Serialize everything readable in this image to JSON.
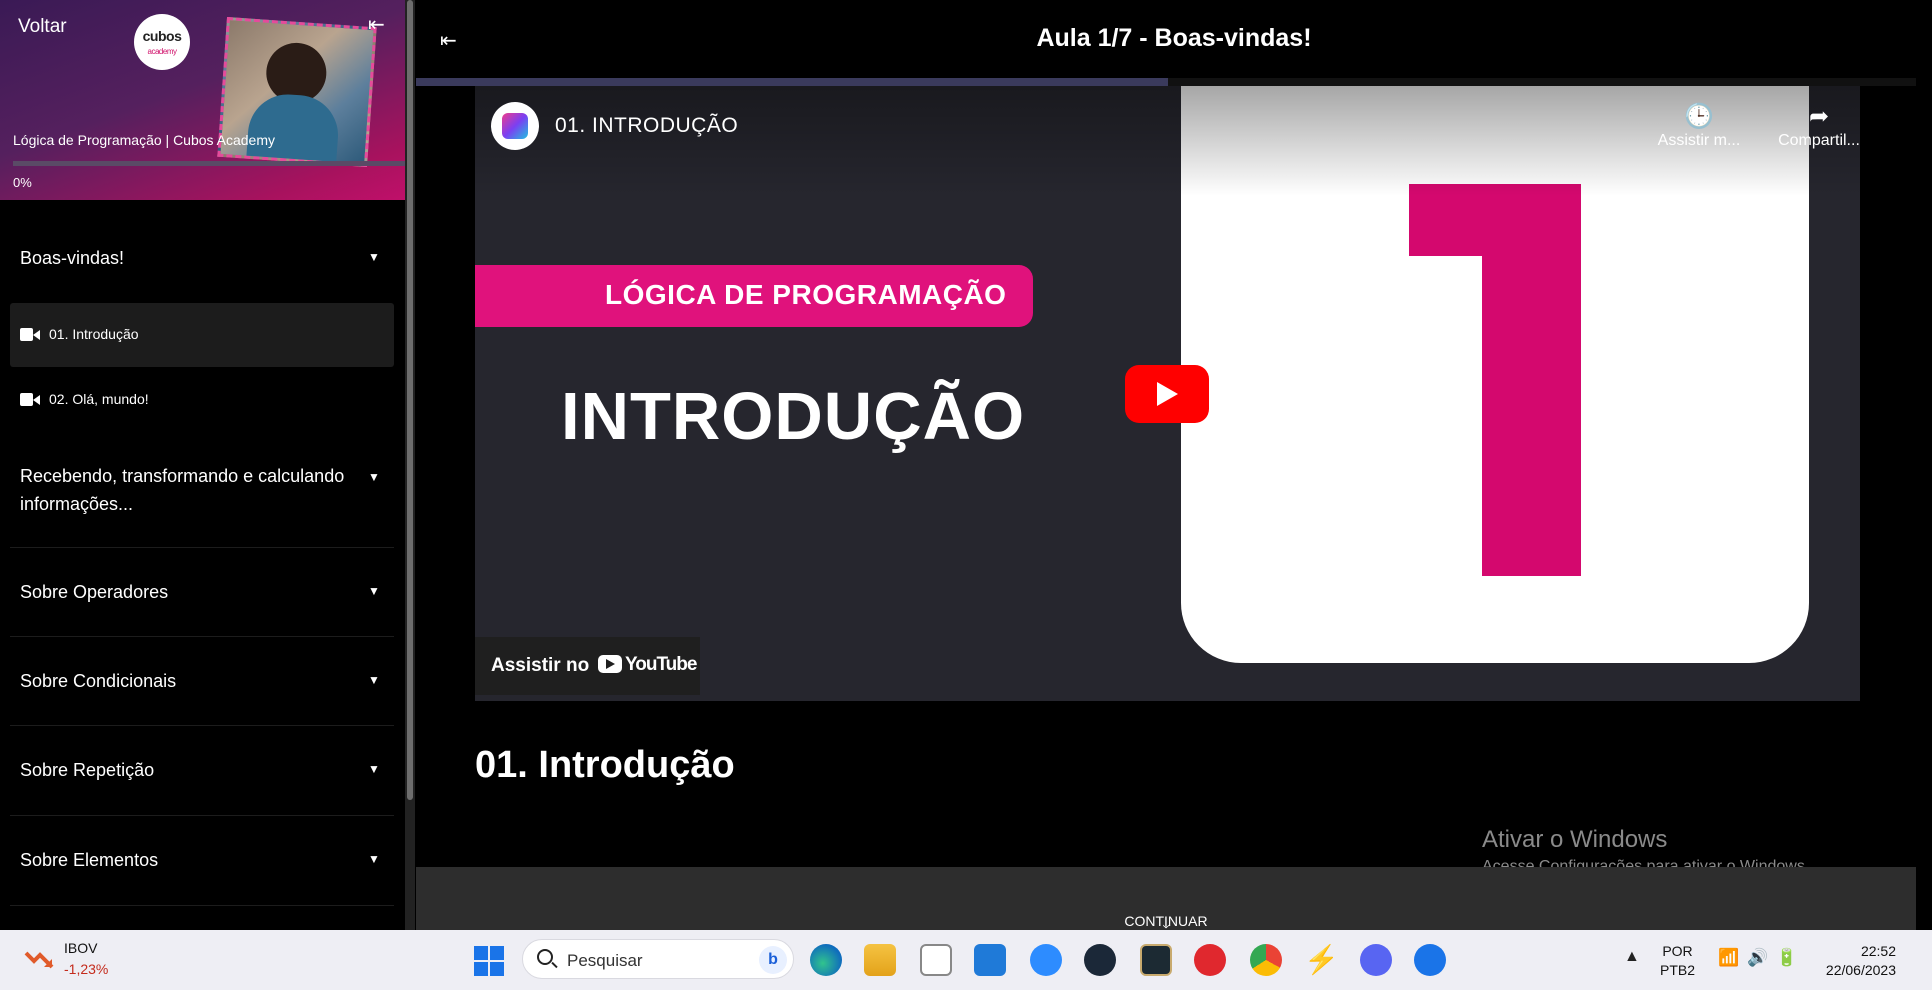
{
  "sidebar": {
    "back_label": "Voltar",
    "logo_text": "cubos",
    "logo_sub": "academy",
    "course_title": "Lógica de Programação | Cubos Academy",
    "progress_text": "0%",
    "progress_value": 0,
    "sections": [
      {
        "label": "Boas-vindas!",
        "expanded": true
      },
      {
        "label": "Recebendo, transformando e calculando informações...",
        "expanded": false
      },
      {
        "label": "Sobre Operadores",
        "expanded": false
      },
      {
        "label": "Sobre Condicionais",
        "expanded": false
      },
      {
        "label": "Sobre Repetição",
        "expanded": false
      },
      {
        "label": "Sobre Elementos",
        "expanded": false
      }
    ],
    "lessons": [
      {
        "label": "01. Introdução",
        "active": true
      },
      {
        "label": "02. Olá, mundo!",
        "active": false
      }
    ]
  },
  "header": {
    "title": "Aula 1/7 - Boas-vindas!"
  },
  "video": {
    "title": "01. INTRODUÇÃO",
    "watch_later": "Assistir m...",
    "share": "Compartil...",
    "banner": "LÓGICA DE PROGRAMAÇÃO",
    "heading": "INTRODUÇÃO",
    "watch_on": "Assistir no",
    "yt_brand": "YouTube"
  },
  "lesson": {
    "title": "01. Introdução"
  },
  "watermark": {
    "line1": "Ativar o Windows",
    "line2": "Acesse Configurações para ativar o Windows."
  },
  "continue_label": "CONTINUAR",
  "taskbar": {
    "widget_name": "IBOV",
    "widget_change": "-1,23%",
    "search_placeholder": "Pesquisar",
    "lang_line1": "POR",
    "lang_line2": "PTB2",
    "time": "22:52",
    "date": "22/06/2023",
    "apps": [
      "edge-icon",
      "file-explorer-icon",
      "store-icon",
      "mail-icon",
      "zoom-icon",
      "steam-icon",
      "league-icon",
      "riot-icon",
      "chrome-icon",
      "bolt-icon",
      "discord-icon",
      "bluetooth-app-icon"
    ]
  },
  "colors": {
    "accent_pink": "#e0127c",
    "youtube_red": "#ff0000"
  }
}
